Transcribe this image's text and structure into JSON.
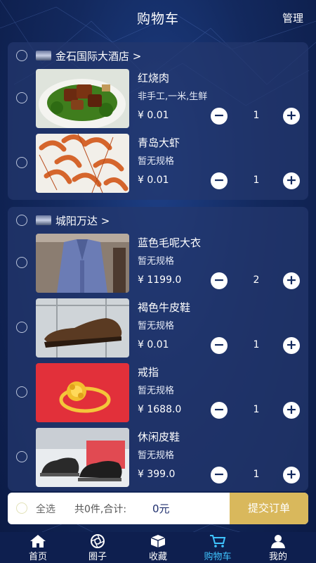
{
  "header": {
    "title": "购物车",
    "manage": "管理"
  },
  "stores": [
    {
      "name": "金石国际大酒店 >",
      "items": [
        {
          "name": "红烧肉",
          "spec": "非手工,一米,生鲜",
          "price": "¥ 0.01",
          "qty": "1",
          "image": "braised-pork-image"
        },
        {
          "name": "青岛大虾",
          "spec": "暂无规格",
          "price": "¥ 0.01",
          "qty": "1",
          "image": "shrimp-image"
        }
      ]
    },
    {
      "name": "城阳万达 >",
      "items": [
        {
          "name": "蓝色毛呢大衣",
          "spec": "暂无规格",
          "price": "¥ 1199.0",
          "qty": "2",
          "image": "blue-coat-image"
        },
        {
          "name": "褐色牛皮鞋",
          "spec": "暂无规格",
          "price": "¥ 0.01",
          "qty": "1",
          "image": "brown-shoe-image"
        },
        {
          "name": "戒指",
          "spec": "暂无规格",
          "price": "¥ 1688.0",
          "qty": "1",
          "image": "gold-ring-image"
        },
        {
          "name": "休闲皮鞋",
          "spec": "暂无规格",
          "price": "¥ 399.0",
          "qty": "1",
          "image": "casual-shoes-image"
        }
      ]
    }
  ],
  "controls": {
    "minus": "−",
    "plus": "+"
  },
  "footer": {
    "select_all": "全选",
    "summary": "共0件,合计:",
    "total": "0元",
    "submit": "提交订单"
  },
  "tabs": [
    {
      "label": "首页",
      "icon": "home-icon"
    },
    {
      "label": "圈子",
      "icon": "aperture-icon"
    },
    {
      "label": "收藏",
      "icon": "box-icon"
    },
    {
      "label": "购物车",
      "icon": "cart-icon",
      "active": true
    },
    {
      "label": "我的",
      "icon": "user-icon"
    }
  ],
  "colors": {
    "accent": "#3fc4ff",
    "submit": "#d9b85c",
    "card": "#24386e"
  }
}
